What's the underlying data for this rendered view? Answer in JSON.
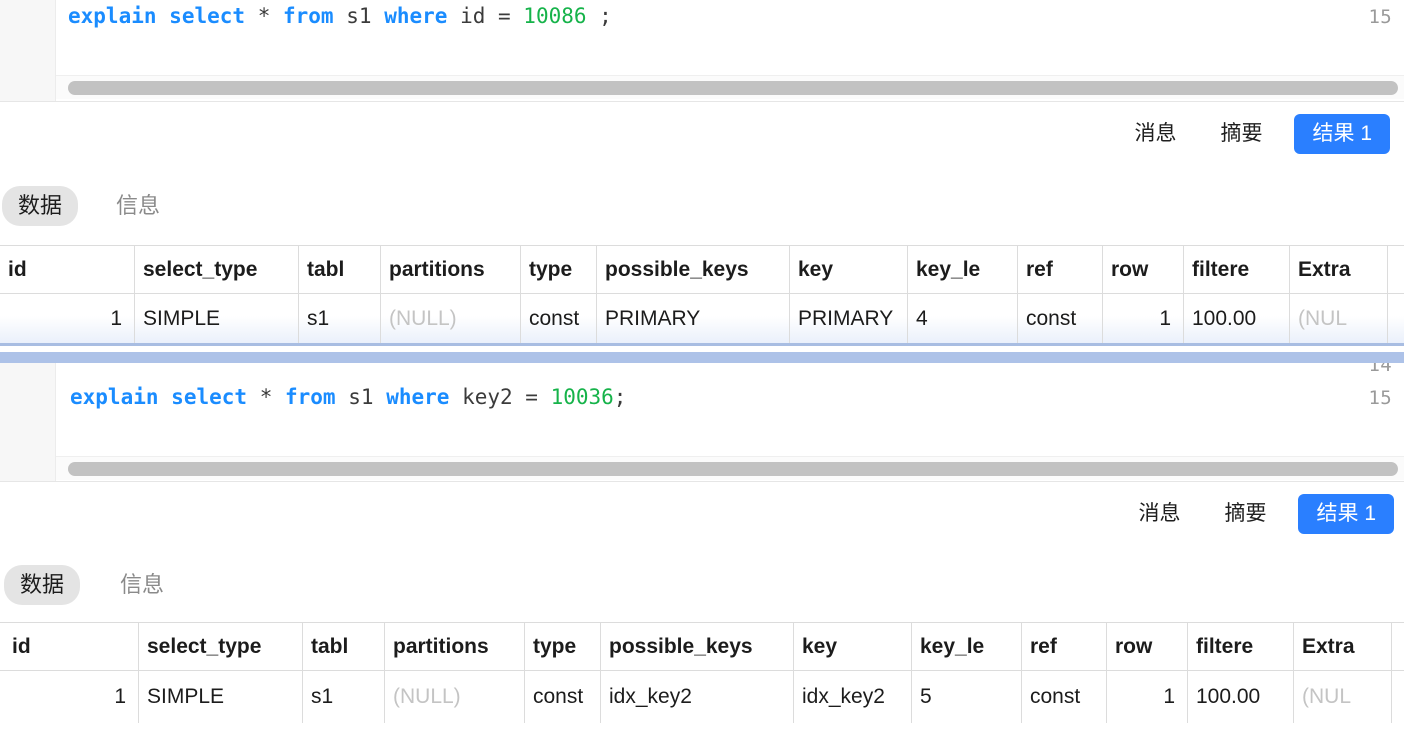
{
  "editor1": {
    "line_number": "15",
    "tokens": [
      {
        "t": "explain",
        "c": "kw"
      },
      {
        "t": " ",
        "c": "plain"
      },
      {
        "t": "select",
        "c": "kw"
      },
      {
        "t": " ",
        "c": "plain"
      },
      {
        "t": "*",
        "c": "op"
      },
      {
        "t": " ",
        "c": "plain"
      },
      {
        "t": "from",
        "c": "kw"
      },
      {
        "t": " ",
        "c": "plain"
      },
      {
        "t": "s1",
        "c": "plain"
      },
      {
        "t": " ",
        "c": "plain"
      },
      {
        "t": "where",
        "c": "kw"
      },
      {
        "t": " ",
        "c": "plain"
      },
      {
        "t": "id",
        "c": "plain"
      },
      {
        "t": " = ",
        "c": "op"
      },
      {
        "t": "10086",
        "c": "num"
      },
      {
        "t": " ;",
        "c": "op"
      }
    ],
    "full_text": "explain select * from s1 where id = 10086 ;"
  },
  "editor2": {
    "line_number_partial": "14",
    "line_number": "15",
    "tokens": [
      {
        "t": "explain",
        "c": "kw"
      },
      {
        "t": " ",
        "c": "plain"
      },
      {
        "t": "select",
        "c": "kw"
      },
      {
        "t": " ",
        "c": "plain"
      },
      {
        "t": "*",
        "c": "op"
      },
      {
        "t": " ",
        "c": "plain"
      },
      {
        "t": "from",
        "c": "kw"
      },
      {
        "t": " ",
        "c": "plain"
      },
      {
        "t": "s1",
        "c": "plain"
      },
      {
        "t": " ",
        "c": "plain"
      },
      {
        "t": "where",
        "c": "kw"
      },
      {
        "t": " ",
        "c": "plain"
      },
      {
        "t": "key2",
        "c": "plain"
      },
      {
        "t": " = ",
        "c": "op"
      },
      {
        "t": "10036",
        "c": "num"
      },
      {
        "t": ";",
        "c": "op"
      }
    ],
    "full_text": "explain select * from s1 where key2 = 10036;"
  },
  "result_tabs": {
    "messages_label": "消息",
    "summary_label": "摘要",
    "result_label": "结果 1"
  },
  "pill_tabs": {
    "data_label": "数据",
    "info_label": "信息"
  },
  "accent_color": "#2a7fff",
  "table": {
    "columns": [
      "id",
      "select_type",
      "tabl",
      "partitions",
      "type",
      "possible_keys",
      "key",
      "key_le",
      "ref",
      "row",
      "filtere",
      "Extra"
    ],
    "rows_table1": [
      {
        "id": "1",
        "select_type": "SIMPLE",
        "tabl": "s1",
        "partitions": "(NULL)",
        "type": "const",
        "possible_keys": "PRIMARY",
        "key": "PRIMARY",
        "key_le": "4",
        "ref": "const",
        "row": "1",
        "filtere": "100.00",
        "Extra": "(NUL"
      }
    ],
    "rows_table2": [
      {
        "id": "1",
        "select_type": "SIMPLE",
        "tabl": "s1",
        "partitions": "(NULL)",
        "type": "const",
        "possible_keys": "idx_key2",
        "key": "idx_key2",
        "key_le": "5",
        "ref": "const",
        "row": "1",
        "filtere": "100.00",
        "Extra": "(NUL"
      }
    ]
  }
}
